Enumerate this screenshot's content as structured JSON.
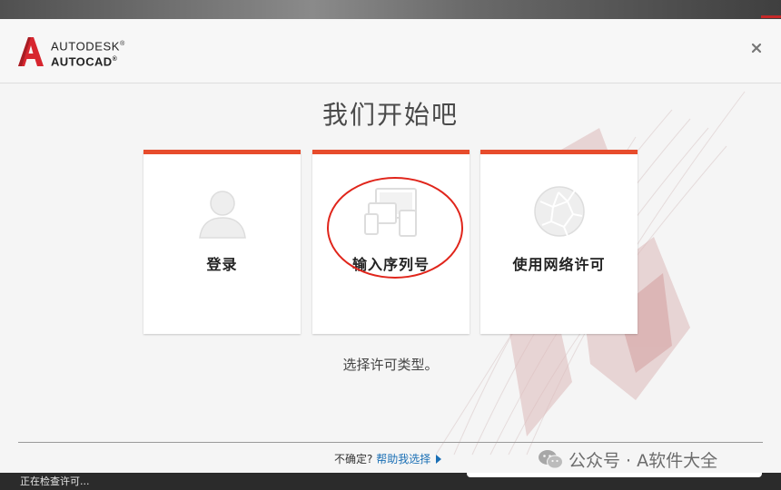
{
  "brand": {
    "line1": "AUTODESK",
    "line1_mark": "®",
    "line2": "AUTOCAD",
    "line2_mark": "®"
  },
  "dialog": {
    "title": "我们开始吧",
    "subtitle": "选择许可类型。",
    "close_icon": "close-icon"
  },
  "cards": [
    {
      "label": "登录",
      "icon": "user-icon"
    },
    {
      "label": "输入序列号",
      "icon": "devices-icon"
    },
    {
      "label": "使用网络许可",
      "icon": "network-globe-icon"
    }
  ],
  "footer": {
    "question": "不确定?",
    "help_link": "帮助我选择"
  },
  "status_bar": {
    "text": "正在检查许可..."
  },
  "watermark": {
    "text": "公众号 · A软件大全",
    "icon": "wechat-icon"
  },
  "colors": {
    "accent": "#e74c2c",
    "link": "#1a6fb5",
    "highlight": "#e0251b",
    "autodesk_red": "#d7262f"
  }
}
